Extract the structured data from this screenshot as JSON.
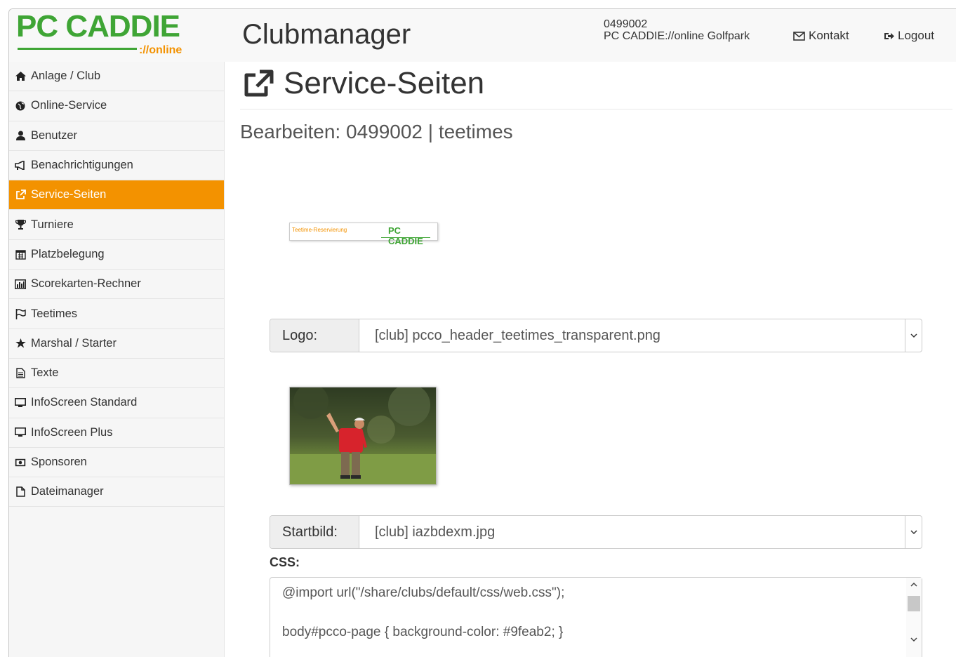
{
  "header": {
    "logo_text": "PC CADDIE",
    "logo_sub": "://online",
    "app_title": "Clubmanager",
    "club_id": "0499002",
    "club_name": "PC CADDIE://online Golfpark",
    "contact_label": "Kontakt",
    "logout_label": "Logout"
  },
  "sidebar": {
    "items": [
      {
        "label": "Anlage / Club",
        "icon": "home-icon",
        "active": false
      },
      {
        "label": "Online-Service",
        "icon": "globe-icon",
        "active": false
      },
      {
        "label": "Benutzer",
        "icon": "user-icon",
        "active": false
      },
      {
        "label": "Benachrichtigungen",
        "icon": "bullhorn-icon",
        "active": false
      },
      {
        "label": "Service-Seiten",
        "icon": "external-link-icon",
        "active": true
      },
      {
        "label": "Turniere",
        "icon": "trophy-icon",
        "active": false
      },
      {
        "label": "Platzbelegung",
        "icon": "calendar-icon",
        "active": false
      },
      {
        "label": "Scorekarten-Rechner",
        "icon": "bar-chart-icon",
        "active": false
      },
      {
        "label": "Teetimes",
        "icon": "flag-icon",
        "active": false
      },
      {
        "label": "Marshal / Starter",
        "icon": "star-icon",
        "active": false
      },
      {
        "label": "Texte",
        "icon": "document-icon",
        "active": false
      },
      {
        "label": "InfoScreen Standard",
        "icon": "monitor-icon",
        "active": false
      },
      {
        "label": "InfoScreen Plus",
        "icon": "monitor-icon",
        "active": false
      },
      {
        "label": "Sponsoren",
        "icon": "money-icon",
        "active": false
      },
      {
        "label": "Dateimanager",
        "icon": "file-icon",
        "active": false
      }
    ]
  },
  "main": {
    "page_title": "Service-Seiten",
    "subtitle": "Bearbeiten: 0499002 | teetimes",
    "logo_preview": {
      "left_text": "Teetime-Reservierung",
      "right_text": "PC CADDIE"
    },
    "logo_field": {
      "label": "Logo:",
      "value": "[club] pcco_header_teetimes_transparent.png"
    },
    "startbild_field": {
      "label": "Startbild:",
      "value": "[club] iazbdexm.jpg"
    },
    "css_label": "CSS:",
    "css_lines": [
      "@import url(\"/share/clubs/default/css/web.css\");",
      "body#pcco-page { background-color: #9feab2; }"
    ]
  },
  "colors": {
    "accent": "#f39200",
    "brand_green": "#3fa535"
  }
}
